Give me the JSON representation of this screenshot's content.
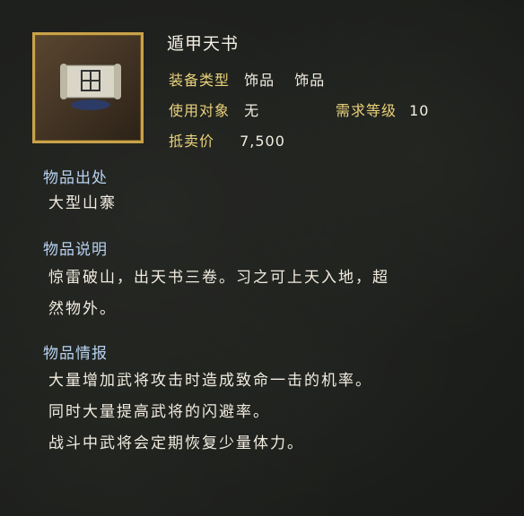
{
  "item": {
    "name": "遁甲天书",
    "type_label": "装备类型",
    "type_value1": "饰品",
    "type_value2": "饰品",
    "target_label": "使用对象",
    "target_value": "无",
    "level_label": "需求等级",
    "level_value": "10",
    "price_label": "抵卖价",
    "price_value": "7,500"
  },
  "sections": {
    "source_title": "物品出处",
    "source_text": "大型山寨",
    "desc_title": "物品说明",
    "desc_line1": "惊雷破山，出天书三卷。习之可上天入地，超",
    "desc_line2": "然物外。",
    "info_title": "物品情报",
    "info_line1": "大量增加武将攻击时造成致命一击的机率。",
    "info_line2": "同时大量提高武将的闪避率。",
    "info_line3": "战斗中武将会定期恢复少量体力。"
  },
  "colors": {
    "label": "#e9d27a",
    "heading": "#b7d2f0",
    "text": "#f1ece0",
    "frame": "#c9a24a"
  }
}
